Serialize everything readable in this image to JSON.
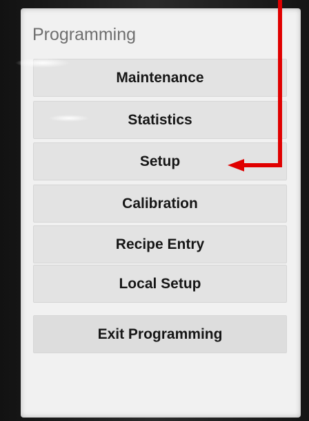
{
  "screen": {
    "title": "Programming"
  },
  "menu": {
    "items": [
      {
        "label": "Maintenance"
      },
      {
        "label": "Statistics"
      },
      {
        "label": "Setup"
      },
      {
        "label": "Calibration"
      },
      {
        "label": "Recipe Entry"
      },
      {
        "label": "Local Setup"
      }
    ],
    "exit_label": "Exit Programming"
  },
  "annotation": {
    "arrow_color": "#e00000",
    "arrow_target": "Setup"
  }
}
